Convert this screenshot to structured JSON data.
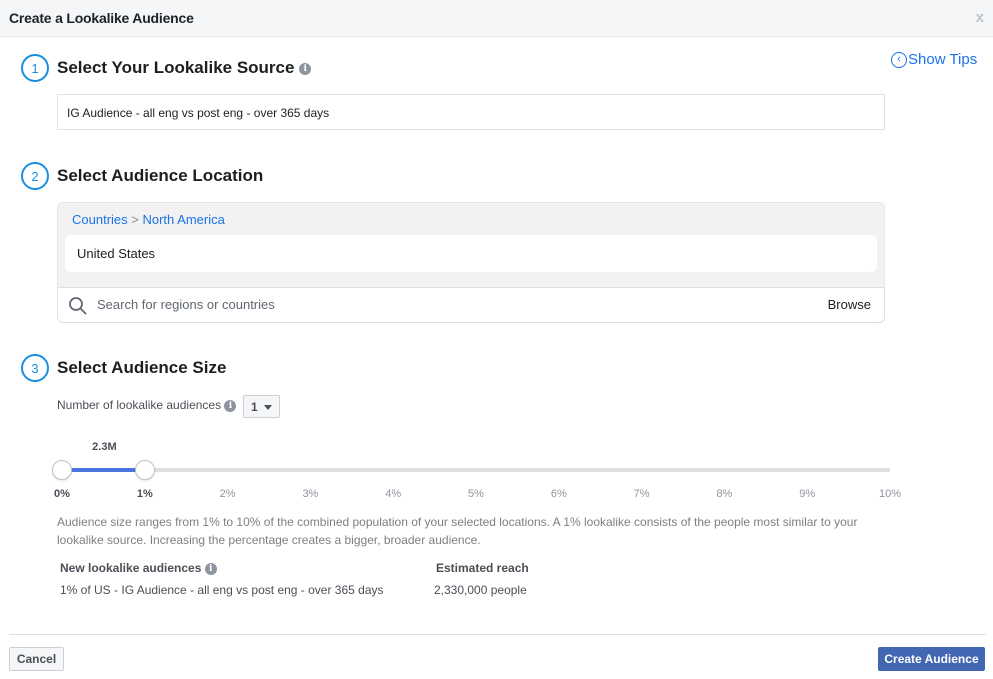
{
  "dialog": {
    "title": "Create a Lookalike Audience",
    "close_label": "x",
    "show_tips_label": "Show Tips"
  },
  "steps": [
    {
      "number": "1",
      "title": "Select Your Lookalike Source"
    },
    {
      "number": "2",
      "title": "Select Audience Location"
    },
    {
      "number": "3",
      "title": "Select Audience Size"
    }
  ],
  "source": {
    "value": "IG Audience - all eng vs post eng - over 365 days"
  },
  "location": {
    "breadcrumb": [
      "Countries",
      "North America"
    ],
    "breadcrumb_separator": ">",
    "selected": [
      "United States"
    ],
    "search_placeholder": "Search for regions or countries",
    "browse_label": "Browse"
  },
  "size": {
    "num_label": "Number of lookalike audiences",
    "num_value": "1",
    "slider": {
      "min_percent": 0,
      "max_percent": 10,
      "range_start_percent": 0,
      "range_end_percent": 1,
      "value_label": "2.3M",
      "ticks": [
        "0%",
        "1%",
        "2%",
        "3%",
        "4%",
        "5%",
        "6%",
        "7%",
        "8%",
        "9%",
        "10%"
      ]
    },
    "description": "Audience size ranges from 1% to 10% of the combined population of your selected locations. A 1% lookalike consists of the people most similar to your lookalike source. Increasing the percentage creates a bigger, broader audience.",
    "table": {
      "headers": [
        "New lookalike audiences",
        "Estimated reach"
      ],
      "rows": [
        [
          "1% of US - IG Audience - all eng vs post eng - over 365 days",
          "2,330,000 people"
        ]
      ]
    }
  },
  "footer": {
    "cancel_label": "Cancel",
    "create_label": "Create Audience"
  },
  "colors": {
    "accent": "#1a8fe0",
    "link": "#1a73e8",
    "slider_fill": "#4a76e0",
    "primary_button": "#4267b2"
  }
}
